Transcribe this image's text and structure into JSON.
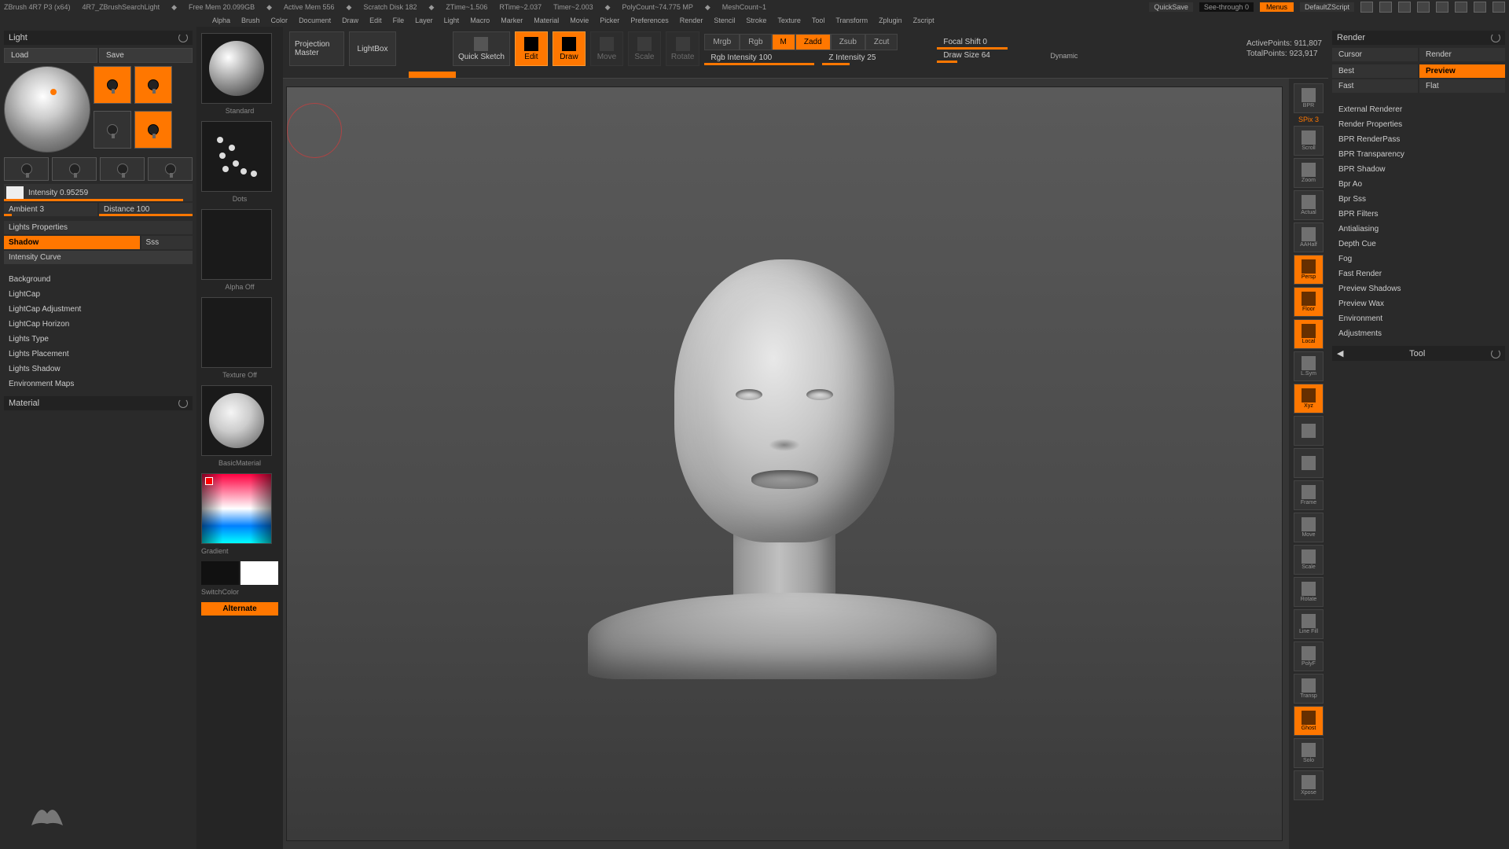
{
  "titlebar": {
    "app": "ZBrush 4R7 P3 (x64)",
    "doc": "4R7_ZBrushSearchLight",
    "freemem": "Free Mem 20.099GB",
    "activemem": "Active Mem 556",
    "scratch": "Scratch Disk 182",
    "ztime": "ZTime~1.506",
    "rtime": "RTime~2.037",
    "timer": "Timer~2.003",
    "poly": "PolyCount~74.775 MP",
    "mesh": "MeshCount~1",
    "quicksave": "QuickSave",
    "seethrough": "See-through  0",
    "menus": "Menus",
    "script": "DefaultZScript"
  },
  "menus": [
    "Alpha",
    "Brush",
    "Color",
    "Document",
    "Draw",
    "Edit",
    "File",
    "Layer",
    "Light",
    "Macro",
    "Marker",
    "Material",
    "Movie",
    "Picker",
    "Preferences",
    "Render",
    "Stencil",
    "Stroke",
    "Texture",
    "Tool",
    "Transform",
    "Zplugin",
    "Zscript"
  ],
  "leftPanel": {
    "title": "Light",
    "load": "Load",
    "save": "Save",
    "intensity": "Intensity 0.95259",
    "ambient": "Ambient 3",
    "distance": "Distance 100",
    "lightsProps": "Lights Properties",
    "shadow": "Shadow",
    "sss": "Sss",
    "intensityCurve": "Intensity Curve",
    "items": [
      "Background",
      "LightCap",
      "LightCap Adjustment",
      "LightCap Horizon",
      "Lights Type",
      "Lights Placement",
      "Lights Shadow",
      "Environment Maps"
    ],
    "material": "Material"
  },
  "tray": {
    "standard": "Standard",
    "dots": "Dots",
    "alphaOff": "Alpha Off",
    "textureOff": "Texture Off",
    "basicMat": "BasicMaterial",
    "gradient": "Gradient",
    "switchColor": "SwitchColor",
    "alternate": "Alternate"
  },
  "toolbar": {
    "projection": "Projection Master",
    "lightbox": "LightBox",
    "quicksketch": "Quick Sketch",
    "edit": "Edit",
    "draw": "Draw",
    "move": "Move",
    "scale": "Scale",
    "rotate": "Rotate",
    "mrgb": "Mrgb",
    "rgb": "Rgb",
    "m": "M",
    "zadd": "Zadd",
    "zsub": "Zsub",
    "zcut": "Zcut",
    "rgbIntensity": "Rgb Intensity 100",
    "zIntensity": "Z Intensity 25",
    "focalShift": "Focal Shift 0",
    "drawSize": "Draw Size 64",
    "dynamic": "Dynamic",
    "activePoints": "ActivePoints: 911,807",
    "totalPoints": "TotalPoints: 923,917"
  },
  "rail": {
    "spix": "SPix 3",
    "items": [
      "BPR",
      "Scroll",
      "Zoom",
      "Actual",
      "AAHalf",
      "Persp",
      "Floor",
      "Local",
      "L.Sym",
      "Xyz",
      "",
      "",
      "Frame",
      "Move",
      "Scale",
      "Rotate",
      "Line Fill",
      "PolyF",
      "Transp",
      "Ghost",
      "Solo",
      "Xpose"
    ]
  },
  "rightPanel": {
    "title": "Render",
    "cursor": "Cursor",
    "render": "Render",
    "best": "Best",
    "preview": "Preview",
    "fast": "Fast",
    "flat": "Flat",
    "items": [
      "External Renderer",
      "Render Properties",
      "BPR RenderPass",
      "BPR Transparency",
      "BPR Shadow",
      "Bpr Ao",
      "Bpr Sss",
      "BPR Filters",
      "Antialiasing",
      "Depth Cue",
      "Fog",
      "Fast Render",
      "Preview Shadows",
      "Preview Wax",
      "Environment",
      "Adjustments"
    ],
    "tool": "Tool"
  }
}
